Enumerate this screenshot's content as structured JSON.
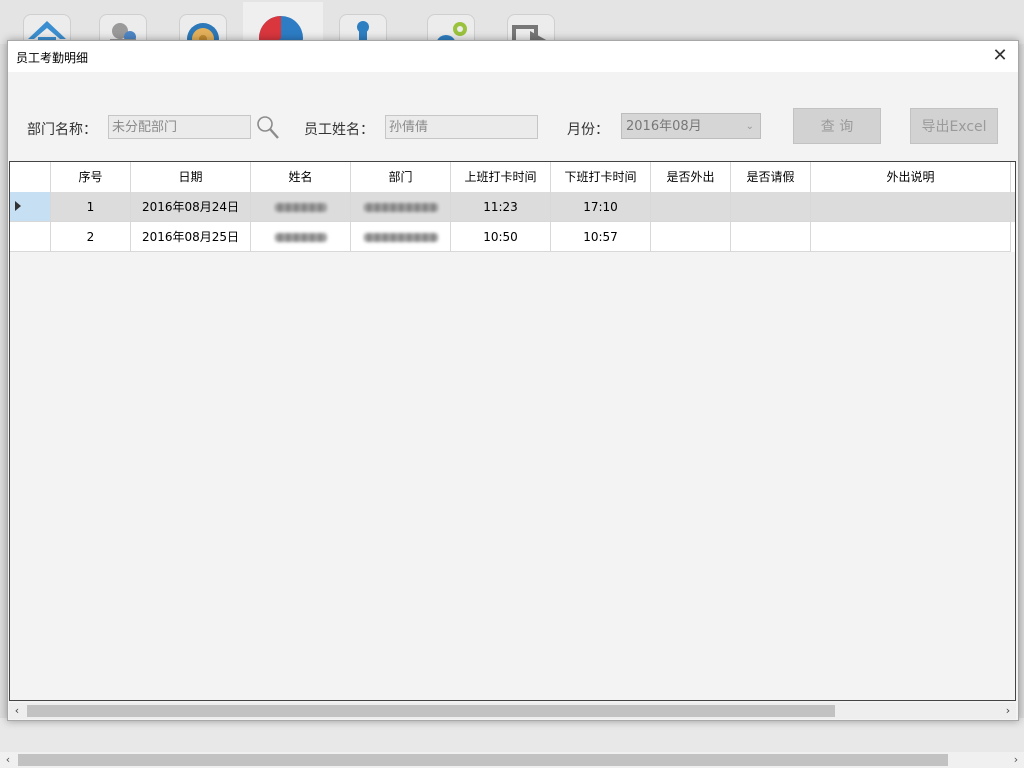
{
  "dialog": {
    "title": "员工考勤明细",
    "close_glyph": "✕"
  },
  "filters": {
    "dept_label": "部门名称：",
    "dept_value": "未分配部门",
    "name_label": "员工姓名：",
    "name_value": "孙倩倩",
    "month_label": "月份：",
    "month_value": "2016年08月"
  },
  "buttons": {
    "query": "查 询",
    "export": "导出Excel"
  },
  "table": {
    "columns": [
      "序号",
      "日期",
      "姓名",
      "部门",
      "上班打卡时间",
      "下班打卡时间",
      "是否外出",
      "是否请假",
      "外出说明"
    ],
    "rows": [
      {
        "no": "1",
        "date": "2016年08月24日",
        "on": "11:23",
        "off": "17:10",
        "out": "",
        "leave": "",
        "note": ""
      },
      {
        "no": "2",
        "date": "2016年08月25日",
        "on": "10:50",
        "off": "10:57",
        "out": "",
        "leave": "",
        "note": ""
      }
    ]
  },
  "scroll": {
    "left": "‹",
    "right": "›"
  },
  "colors": {
    "selected_row": "#dcdcdc",
    "row_header_selected": "#c7dff3"
  }
}
